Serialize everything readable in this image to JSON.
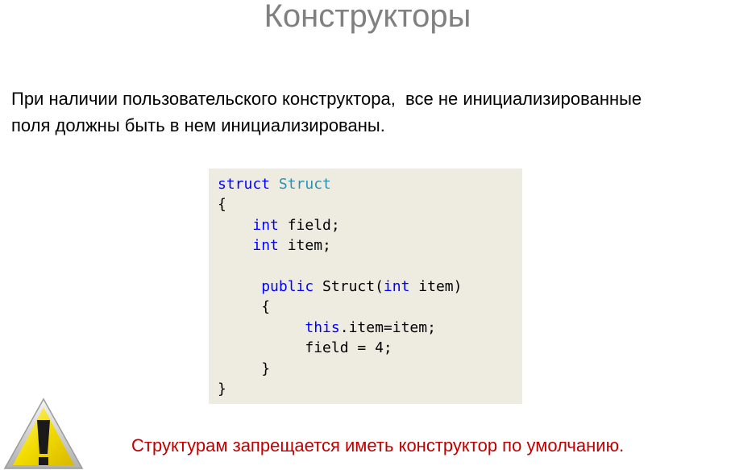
{
  "title": "Конструкторы",
  "body": {
    "line1": "При наличии пользовательского конструктора,  все не инициализированные",
    "line2": "поля должны быть в нем инициализированы."
  },
  "code": {
    "l1_kw": "struct",
    "l1_type": "Struct",
    "l2": "{",
    "l3_kw": "int",
    "l3_rest": " field;",
    "l4_kw": "int",
    "l4_rest": " item;",
    "l6_kw": "public",
    "l6_mid": " Struct(",
    "l6_kw2": "int",
    "l6_rest": " item)",
    "l7": "{",
    "l8_kw": "this",
    "l8_rest": ".item=item;",
    "l9": "field = 4;",
    "l10": "}",
    "l11": "}"
  },
  "warning": {
    "icon": "warning-icon",
    "text": "Структурам запрещается иметь конструктор по умолчанию."
  },
  "colors": {
    "title": "#808080",
    "keyword": "#0000ff",
    "type": "#2b91af",
    "code_background": "#eeece1",
    "warning_text": "#c00000"
  }
}
